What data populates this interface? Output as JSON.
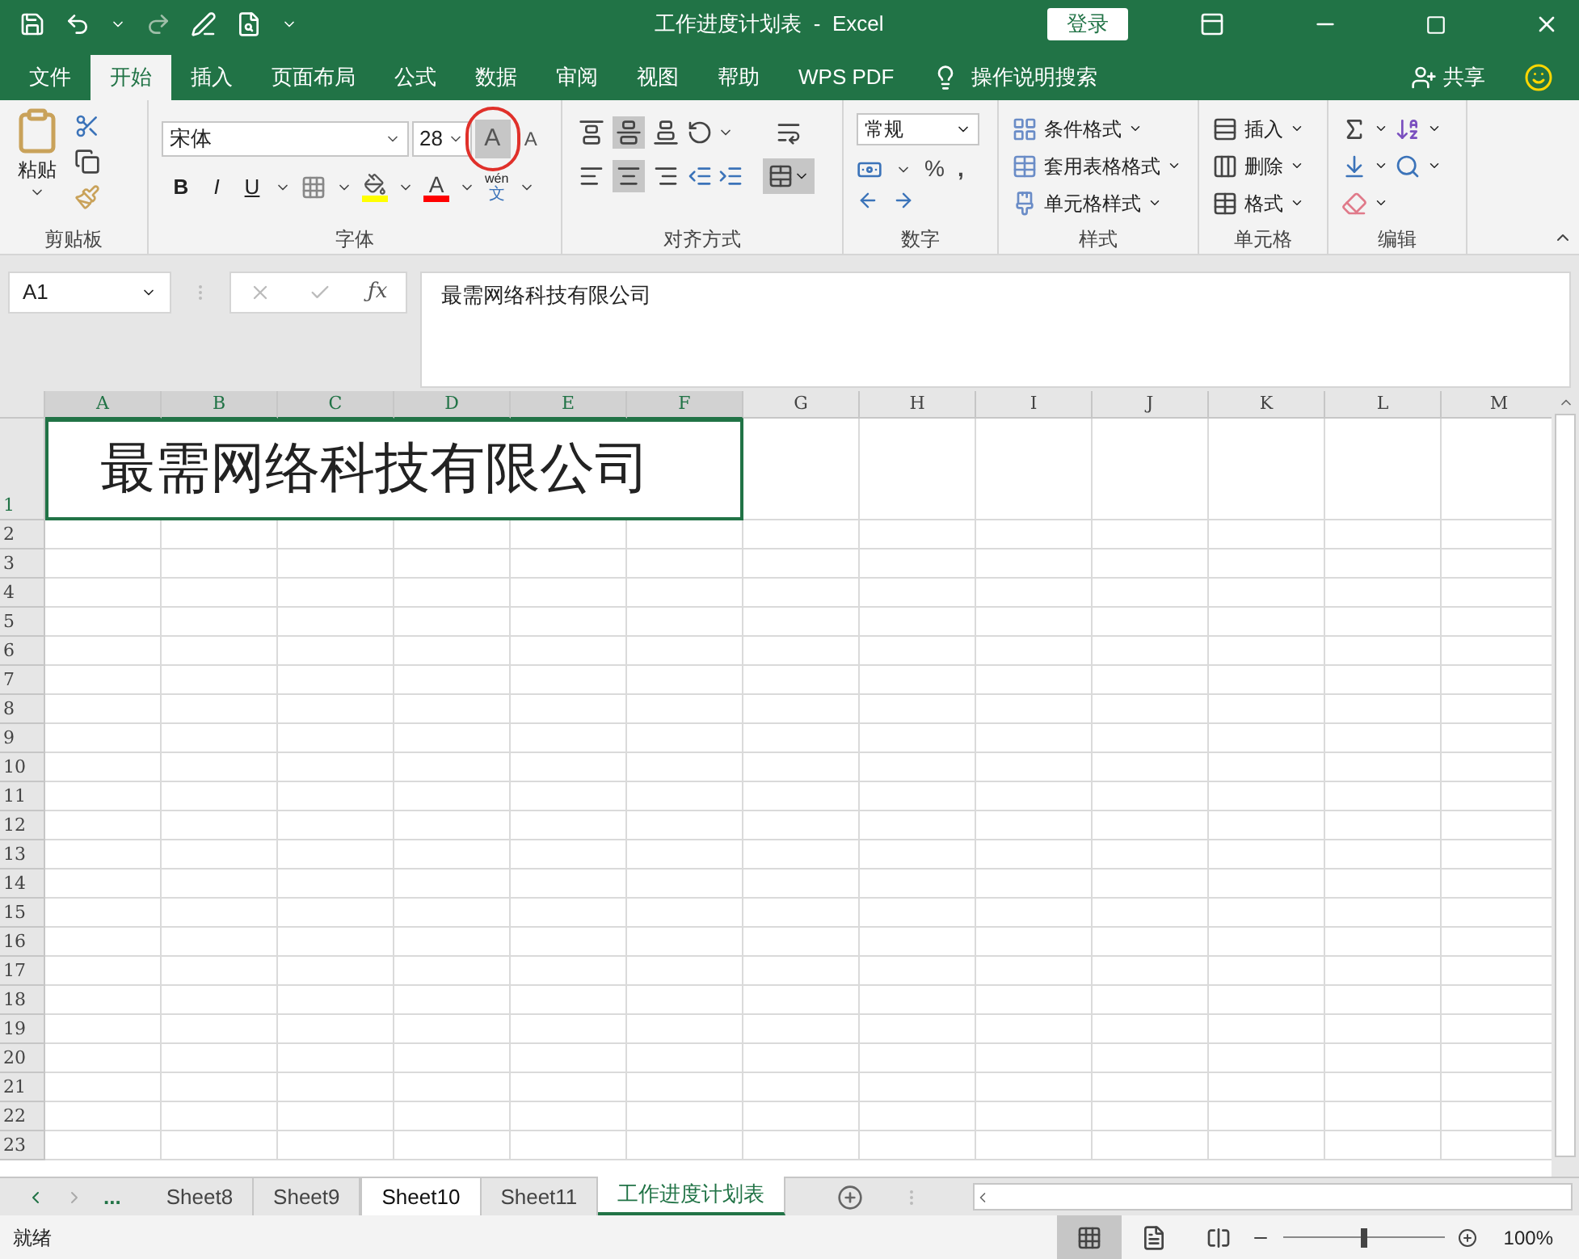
{
  "title_bar": {
    "title": "工作进度计划表  -  Excel",
    "login": "登录"
  },
  "menu_tabs": [
    {
      "label": "文件",
      "selected": false
    },
    {
      "label": "开始",
      "selected": true
    },
    {
      "label": "插入",
      "selected": false
    },
    {
      "label": "页面布局",
      "selected": false
    },
    {
      "label": "公式",
      "selected": false
    },
    {
      "label": "数据",
      "selected": false
    },
    {
      "label": "审阅",
      "selected": false
    },
    {
      "label": "视图",
      "selected": false
    },
    {
      "label": "帮助",
      "selected": false
    },
    {
      "label": "WPS PDF",
      "selected": false
    }
  ],
  "tell_me": "操作说明搜索",
  "share": "共享",
  "ribbon": {
    "clipboard": {
      "paste": "粘贴",
      "label": "剪贴板"
    },
    "font": {
      "name": "宋体",
      "size": "28",
      "grow": "A",
      "grow_highlighted": true,
      "shrink": "A",
      "bold": "B",
      "italic": "I",
      "underline": "U",
      "font_color": "A",
      "phonetic_top": "wén",
      "phonetic_bottom": "文",
      "label": "字体"
    },
    "alignment": {
      "label": "对齐方式",
      "top_align_selected": false,
      "middle_align_selected": true,
      "left_selected": false,
      "center_selected": true,
      "merge_selected": true
    },
    "number": {
      "format": "常规",
      "percent": "%",
      "comma": ",",
      "label": "数字"
    },
    "styles": {
      "items": [
        "条件格式",
        "套用表格格式",
        "单元格样式"
      ],
      "label": "样式"
    },
    "cells": {
      "items": [
        "插入",
        "删除",
        "格式"
      ],
      "label": "单元格"
    },
    "editing": {
      "label": "编辑"
    }
  },
  "formula_bar": {
    "name_box": "A1",
    "function_label": "ƒx",
    "content": "最需网络科技有限公司"
  },
  "sheet": {
    "columns": [
      "A",
      "B",
      "C",
      "D",
      "E",
      "F",
      "G",
      "H",
      "I",
      "J",
      "K",
      "L",
      "M"
    ],
    "rows": [
      "1",
      "2",
      "3",
      "4",
      "5",
      "6",
      "7",
      "8",
      "9",
      "10",
      "11",
      "12",
      "13",
      "14",
      "15",
      "16",
      "17",
      "18",
      "19",
      "20",
      "21",
      "22",
      "23"
    ],
    "a1": "最需网络科技有限公司"
  },
  "sheet_tabs": {
    "more": "...",
    "tabs": [
      {
        "label": "Sheet8",
        "selected": false,
        "highlighted": false
      },
      {
        "label": "Sheet9",
        "selected": false,
        "highlighted": false
      },
      {
        "label": "Sheet10",
        "selected": false,
        "highlighted": true
      },
      {
        "label": "Sheet11",
        "selected": false,
        "highlighted": false
      },
      {
        "label": "工作进度计划表",
        "selected": true,
        "highlighted": false
      }
    ]
  },
  "status_bar": {
    "status": "就绪",
    "zoom": "100%",
    "zoom_slider": {
      "level": 0.5
    }
  }
}
